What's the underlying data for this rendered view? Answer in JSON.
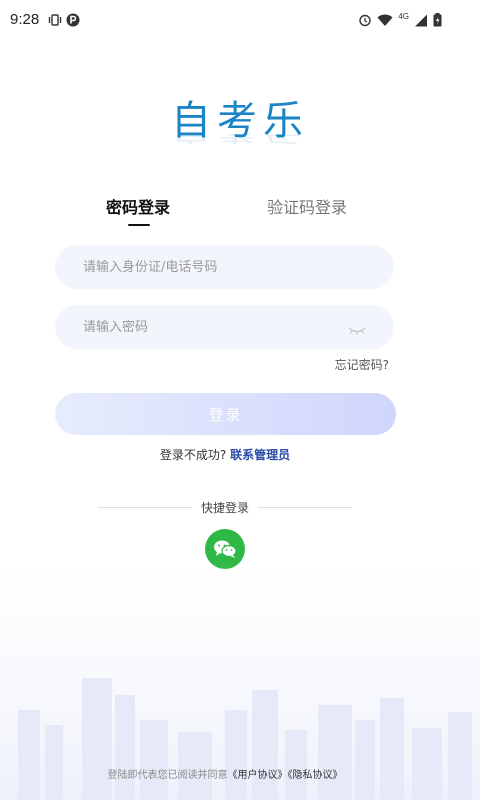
{
  "status_bar": {
    "time": "9:28",
    "network": "4G",
    "icons": [
      "vibrate-icon",
      "parking-icon",
      "alarm-icon",
      "wifi-icon",
      "signal-icon",
      "battery-icon"
    ]
  },
  "logo": {
    "text": "自考乐"
  },
  "tabs": [
    {
      "label": "密码登录",
      "active": true
    },
    {
      "label": "验证码登录",
      "active": false
    }
  ],
  "form": {
    "id_placeholder": "请输入身份证/电话号码",
    "password_placeholder": "请输入密码",
    "forgot_label": "忘记密码?",
    "login_label": "登录",
    "fail_text": "登录不成功?",
    "contact_label": "联系管理员"
  },
  "quick_login": {
    "label": "快捷登录",
    "icon": "wechat-icon"
  },
  "agreement": {
    "prefix": "登陆即代表您已阅读并同意",
    "user_agreement": "《用户协议》",
    "privacy_policy": "《隐私协议》"
  },
  "colors": {
    "brand": "#1b84c5",
    "input_bg": "#f2f5fb",
    "button_start": "#e7ecfd",
    "button_end": "#cfd6fb",
    "link": "#2b4da8",
    "wechat": "#2fb846"
  }
}
